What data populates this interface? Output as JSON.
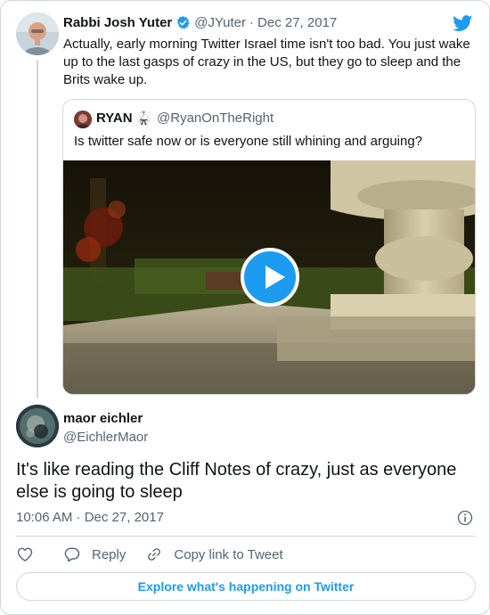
{
  "colors": {
    "accent": "#1d9bf0",
    "muted": "#536471",
    "text": "#0f1419",
    "border": "#cfd9de"
  },
  "tweet": {
    "author_name": "Rabbi Josh Yuter",
    "author_handle": "@JYuter",
    "separator": "·",
    "date": "Dec 27, 2017",
    "text": "Actually, early morning Twitter Israel time isn't too bad. You just wake up to the last gasps of crazy in the US, but they go to sleep and the Brits wake up.",
    "verified": true
  },
  "quoted": {
    "author_name": "RYAN",
    "emoji": "🥋",
    "author_handle": "@RyanOnTheRight",
    "text": "Is twitter safe now or is everyone still whining and arguing?"
  },
  "reply": {
    "author_name": "maor eichler",
    "author_handle": "@EichlerMaor",
    "text": "It's like reading the Cliff Notes of crazy, just as everyone else is going to sleep",
    "timestamp": "10:06 AM · Dec 27, 2017"
  },
  "actions": {
    "reply_label": "Reply",
    "copy_label": "Copy link to Tweet"
  },
  "explore_label": "Explore what's happening on Twitter"
}
